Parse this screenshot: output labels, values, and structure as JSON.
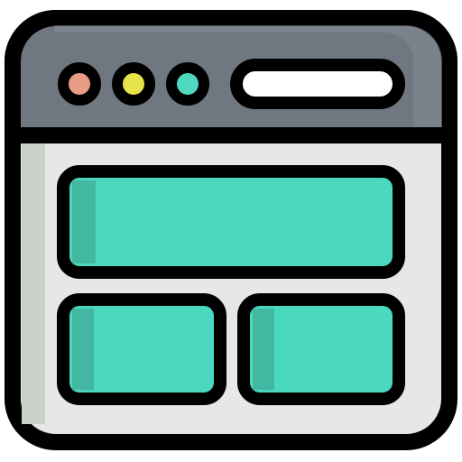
{
  "window": {
    "type": "browser-window-icon",
    "title_bar": {
      "controls": [
        {
          "name": "close-dot-icon",
          "color": "#E89C86"
        },
        {
          "name": "minimize-dot-icon",
          "color": "#E7E34A"
        },
        {
          "name": "maximize-dot-icon",
          "color": "#4ED8BE"
        }
      ],
      "address_bar": {
        "name": "address-bar-icon",
        "color": "#FFFFFF"
      }
    },
    "content": {
      "blocks": [
        {
          "name": "content-block-top",
          "color": "#4AD9BE"
        },
        {
          "name": "content-block-bottom-left",
          "color": "#4AD9BE"
        },
        {
          "name": "content-block-bottom-right",
          "color": "#4AD9BE"
        }
      ]
    },
    "colors": {
      "outline": "#000000",
      "title_bar": "#6F7780",
      "title_bar_highlight": "#848C95",
      "body": "#E5E8E4",
      "body_shadow": "#CBD0CB",
      "block_shadow": "#42B8A2"
    }
  }
}
